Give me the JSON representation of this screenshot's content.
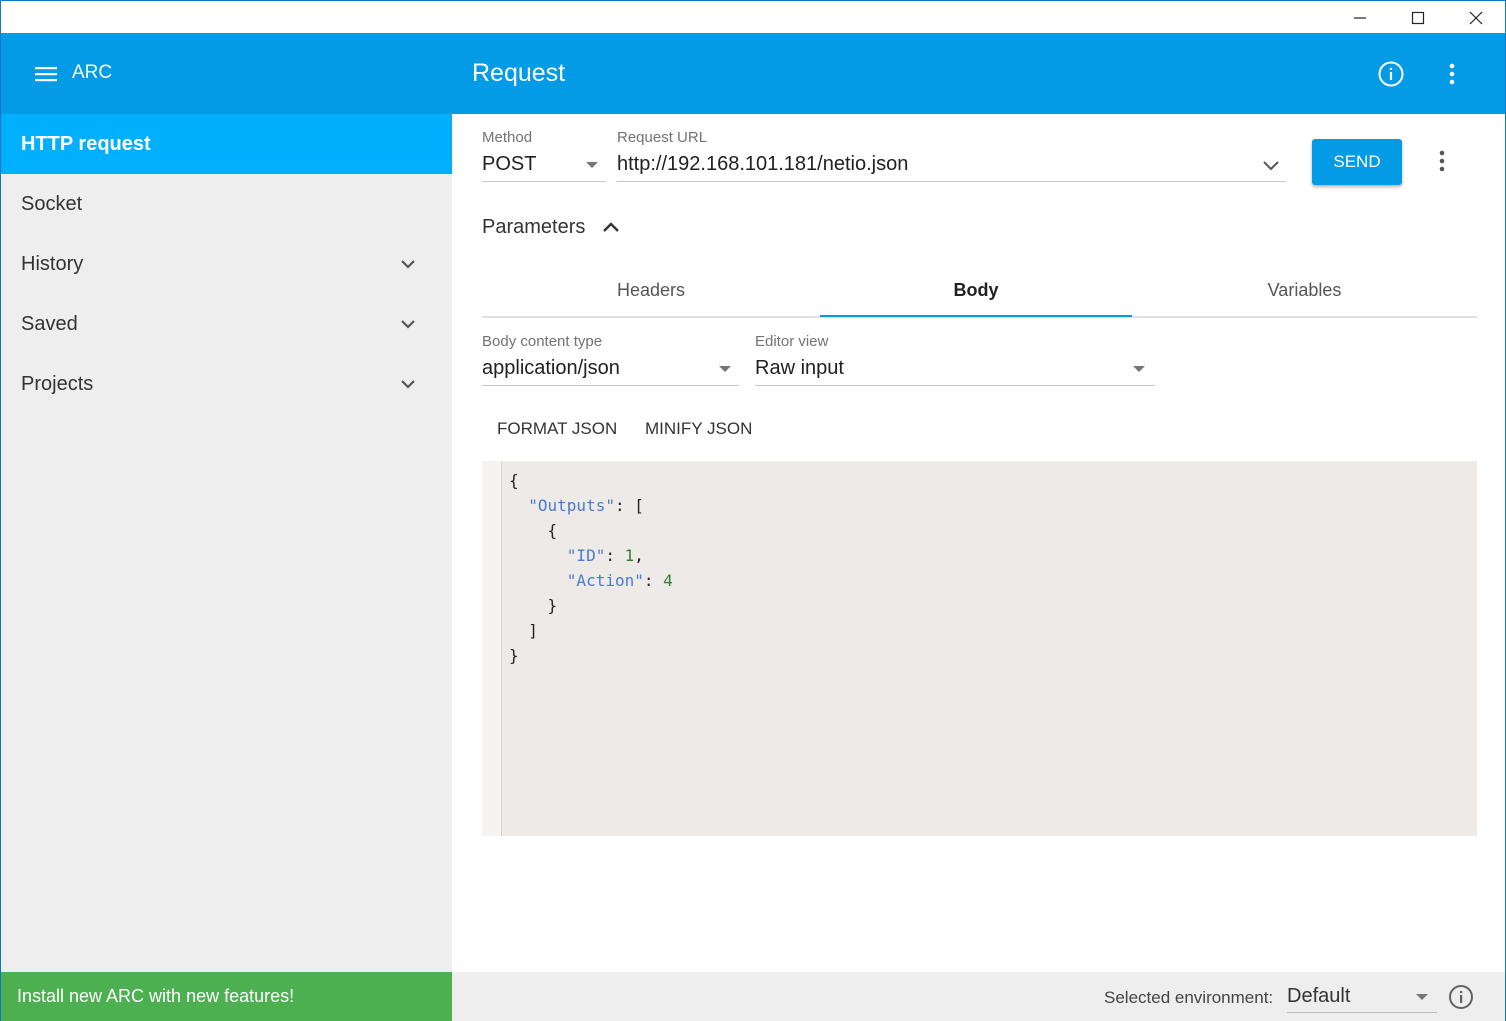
{
  "app": {
    "name": "ARC",
    "page_title": "Request"
  },
  "window_controls": [
    "minimize-icon",
    "maximize-icon",
    "close-icon"
  ],
  "sidebar": {
    "items": [
      {
        "label": "HTTP request",
        "active": true,
        "expandable": false
      },
      {
        "label": "Socket",
        "active": false,
        "expandable": false
      },
      {
        "label": "History",
        "active": false,
        "expandable": true
      },
      {
        "label": "Saved",
        "active": false,
        "expandable": true
      },
      {
        "label": "Projects",
        "active": false,
        "expandable": true
      }
    ],
    "banner": "Install new ARC with new features!"
  },
  "request": {
    "method_label": "Method",
    "method_value": "POST",
    "url_label": "Request URL",
    "url_value": "http://192.168.101.181/netio.json",
    "send_label": "SEND"
  },
  "parameters": {
    "label": "Parameters",
    "tabs": [
      {
        "label": "Headers",
        "active": false
      },
      {
        "label": "Body",
        "active": true
      },
      {
        "label": "Variables",
        "active": false
      }
    ]
  },
  "body": {
    "content_type_label": "Body content type",
    "content_type_value": "application/json",
    "editor_view_label": "Editor view",
    "editor_view_value": "Raw input",
    "format_label": "FORMAT JSON",
    "minify_label": "MINIFY JSON",
    "code": {
      "outputs_key": "\"Outputs\"",
      "id_key": "\"ID\"",
      "id_value": "1",
      "action_key": "\"Action\"",
      "action_value": "4"
    }
  },
  "status": {
    "env_label": "Selected environment:",
    "env_value": "Default"
  },
  "colors": {
    "primary": "#039be5",
    "active_nav": "#00b0ff",
    "banner": "#4caf50",
    "drawer_bg": "#eeeeee",
    "editor_bg": "#edeae7"
  }
}
